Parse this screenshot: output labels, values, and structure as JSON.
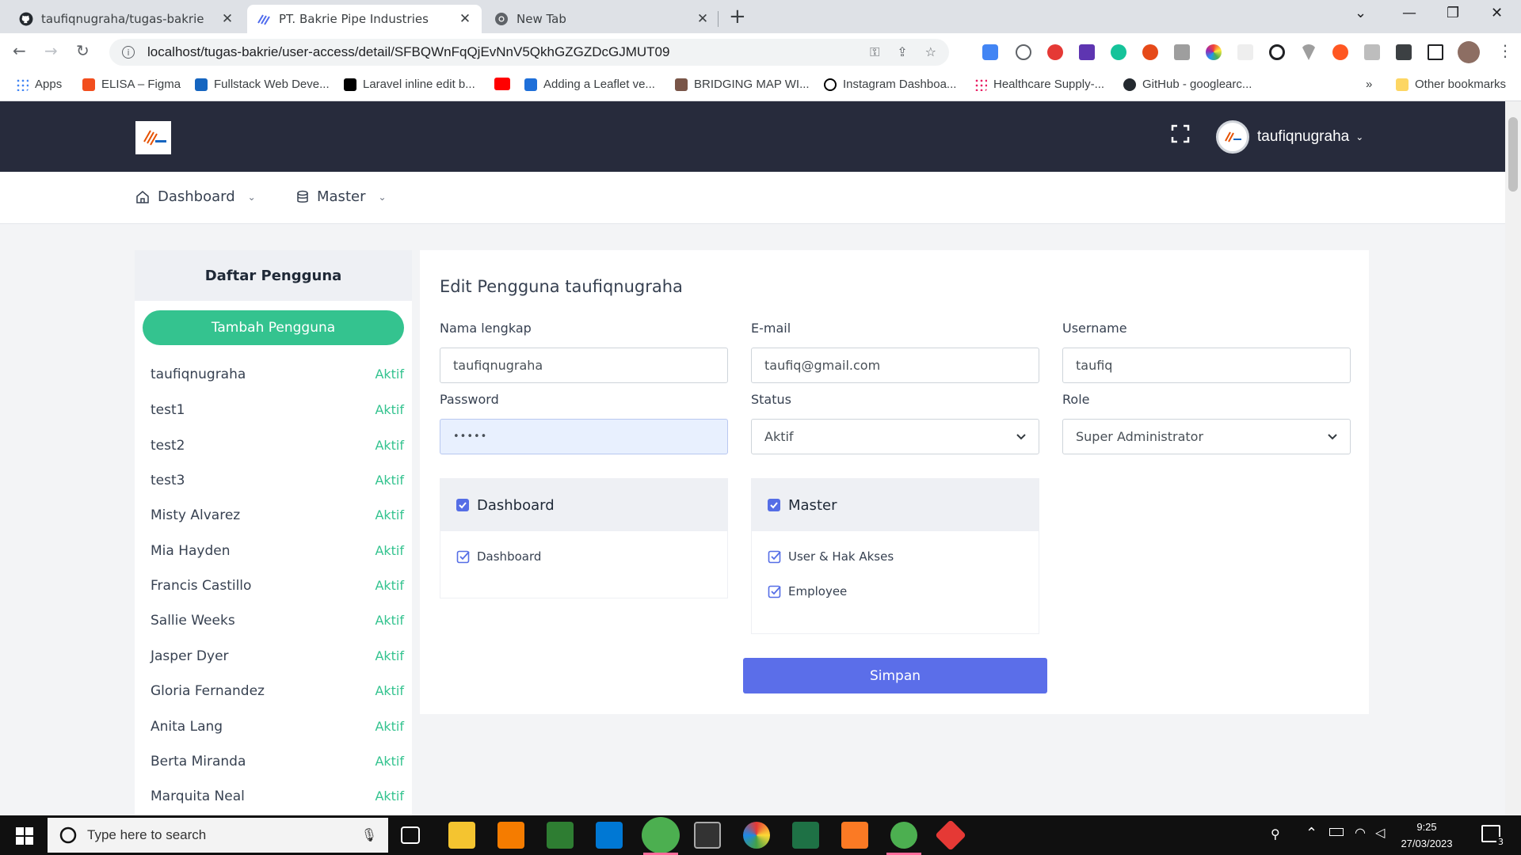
{
  "browser": {
    "tabs": [
      {
        "title": "taufiqnugraha/tugas-bakrie",
        "icon": "github-icon"
      },
      {
        "title": "PT. Bakrie Pipe Industries",
        "icon": "site-icon"
      },
      {
        "title": "New Tab",
        "icon": "chrome-icon"
      }
    ],
    "url": "localhost/tugas-bakrie/user-access/detail/SFBQWnFqQjEvNnV5QkhGZGZDcGJMUT09",
    "bookmarks": [
      "Apps",
      "ELISA – Figma",
      "Fullstack Web Deve...",
      "Laravel inline edit b...",
      "Adding a Leaflet ve...",
      "BRIDGING MAP WI...",
      "Instagram Dashboa...",
      "Healthcare Supply-...",
      "GitHub - googlearc..."
    ],
    "bookmarks_more": "»",
    "other_bookmarks": "Other bookmarks"
  },
  "app": {
    "logo_text": "Bakrie Pipe Industries",
    "user": "taufiqnugraha",
    "nav": [
      {
        "label": "Dashboard"
      },
      {
        "label": "Master"
      }
    ]
  },
  "sidebar": {
    "title": "Daftar Pengguna",
    "add_button": "Tambah Pengguna",
    "users": [
      {
        "name": "taufiqnugraha",
        "status": "Aktif"
      },
      {
        "name": "test1",
        "status": "Aktif"
      },
      {
        "name": "test2",
        "status": "Aktif"
      },
      {
        "name": "test3",
        "status": "Aktif"
      },
      {
        "name": "Misty Alvarez",
        "status": "Aktif"
      },
      {
        "name": "Mia Hayden",
        "status": "Aktif"
      },
      {
        "name": "Francis Castillo",
        "status": "Aktif"
      },
      {
        "name": "Sallie Weeks",
        "status": "Aktif"
      },
      {
        "name": "Jasper Dyer",
        "status": "Aktif"
      },
      {
        "name": "Gloria Fernandez",
        "status": "Aktif"
      },
      {
        "name": "Anita Lang",
        "status": "Aktif"
      },
      {
        "name": "Berta Miranda",
        "status": "Aktif"
      },
      {
        "name": "Marquita Neal",
        "status": "Aktif"
      }
    ]
  },
  "form": {
    "title": "Edit Pengguna taufiqnugraha",
    "fields": {
      "fullname": {
        "label": "Nama lengkap",
        "value": "taufiqnugraha"
      },
      "email": {
        "label": "E-mail",
        "value": "taufiq@gmail.com"
      },
      "username": {
        "label": "Username",
        "value": "taufiq"
      },
      "password": {
        "label": "Password",
        "value": "•••••"
      },
      "status": {
        "label": "Status",
        "value": "Aktif"
      },
      "role": {
        "label": "Role",
        "value": "Super Administrator"
      }
    },
    "permissions": [
      {
        "group": "Dashboard",
        "checked": true,
        "items": [
          {
            "label": "Dashboard",
            "checked": true
          }
        ]
      },
      {
        "group": "Master",
        "checked": true,
        "items": [
          {
            "label": "User & Hak Akses",
            "checked": true
          },
          {
            "label": "Employee",
            "checked": true
          }
        ]
      }
    ],
    "save_button": "Simpan"
  },
  "taskbar": {
    "search_placeholder": "Type here to search",
    "time": "9:25",
    "date": "27/03/2023",
    "notifications": "3"
  },
  "colors": {
    "header_bg": "#272b3c",
    "success": "#34c38f",
    "primary": "#5b6ee9"
  }
}
